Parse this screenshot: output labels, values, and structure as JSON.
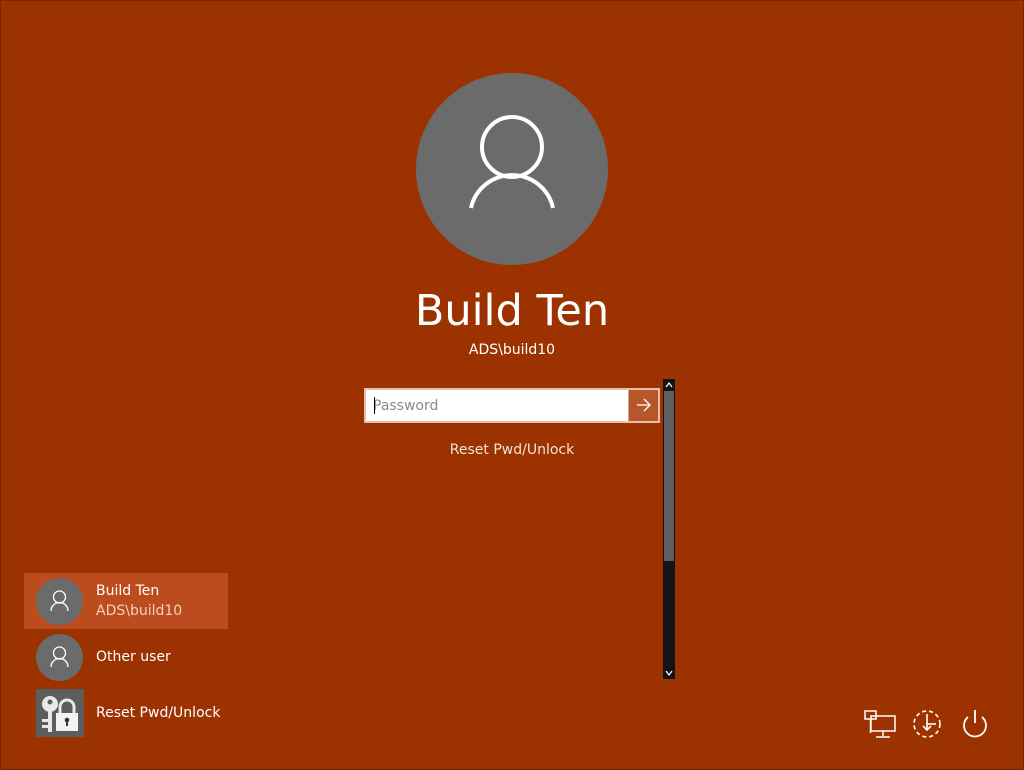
{
  "login": {
    "display_name": "Build Ten",
    "account": "ADS\\build10",
    "password_placeholder": "Password",
    "reset_link": "Reset Pwd/Unlock"
  },
  "user_list": [
    {
      "name": "Build Ten",
      "sub": "ADS\\build10",
      "selected": true,
      "icon": "user-icon"
    },
    {
      "name": "Other user",
      "selected": false,
      "icon": "user-icon"
    },
    {
      "name": "Reset Pwd/Unlock",
      "selected": false,
      "icon": "key-lock-icon"
    }
  ],
  "bottom_icons": [
    {
      "name": "network-icon"
    },
    {
      "name": "ease-of-access-icon"
    },
    {
      "name": "power-icon"
    }
  ],
  "colors": {
    "background": "#9B3200",
    "selected_tile": "#BC4C1E",
    "avatar": "#6B6B6B"
  }
}
